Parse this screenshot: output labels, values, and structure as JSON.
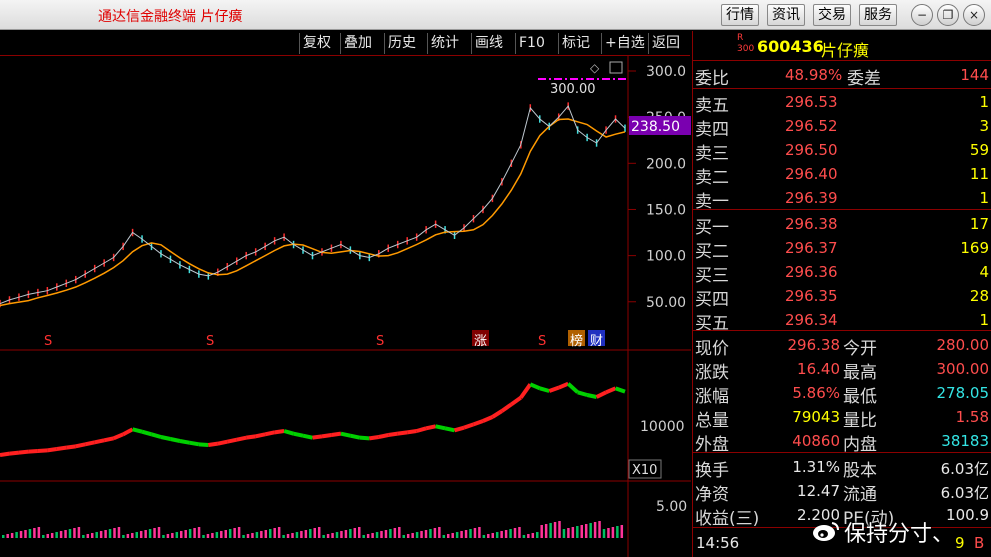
{
  "titlebar": {
    "app_title": "通达信金融终端  片仔癀",
    "buttons": [
      "行情",
      "资讯",
      "交易",
      "服务"
    ],
    "window_controls": [
      "minimize-icon",
      "restore-icon",
      "close-icon"
    ]
  },
  "toolbar": {
    "items": [
      "复权",
      "叠加",
      "历史",
      "统计",
      "画线",
      "F10",
      "标记",
      "+自选",
      "返回"
    ]
  },
  "chart": {
    "price_axis_labels": [
      "300.0",
      "250.0",
      "200.0",
      "150.0",
      "100.0",
      "50.00"
    ],
    "current_price_tag": "238.50",
    "high_marker": "300.00",
    "volume_axis_label": "10000",
    "volume_scale": "X10",
    "indicator_axis_label": "5.00",
    "event_markers": [
      "S",
      "S",
      "S",
      "涨",
      "S",
      "榜",
      "财"
    ],
    "colors": {
      "up": "#ff2020",
      "down": "#00d000",
      "ma": "#ff9a00",
      "tag": "#7a00b0"
    }
  },
  "chart_data": {
    "type": "line",
    "title": "",
    "xlabel": "",
    "ylabel": "",
    "ylim": [
      40,
      300
    ],
    "series": [
      {
        "values": [
          48,
          52,
          55,
          58,
          60,
          62,
          66,
          70,
          74,
          80,
          86,
          92,
          98,
          110,
          125,
          118,
          110,
          102,
          96,
          90,
          85,
          80,
          78,
          82,
          88,
          94,
          100,
          104,
          110,
          116,
          120,
          112,
          106,
          100,
          104,
          108,
          112,
          106,
          100,
          98,
          102,
          108,
          112,
          116,
          120,
          128,
          134,
          128,
          122,
          130,
          140,
          150,
          162,
          180,
          200,
          220,
          260,
          248,
          240,
          250,
          262,
          236,
          228,
          222,
          236,
          248,
          238
        ]
      }
    ],
    "volume": {
      "ylim": [
        0,
        20000
      ]
    },
    "indicator": {
      "ylim": [
        0,
        10
      ]
    }
  },
  "panel": {
    "badge_r": "R",
    "badge_300": "300",
    "code": "600436",
    "name": "片仔癀",
    "weibi": {
      "label": "委比",
      "value": "48.98%",
      "label2": "委差",
      "value2": "144"
    },
    "asks": [
      {
        "label": "卖五",
        "price": "296.53",
        "vol": "1"
      },
      {
        "label": "卖四",
        "price": "296.52",
        "vol": "3"
      },
      {
        "label": "卖三",
        "price": "296.50",
        "vol": "59"
      },
      {
        "label": "卖二",
        "price": "296.40",
        "vol": "11"
      },
      {
        "label": "卖一",
        "price": "296.39",
        "vol": "1"
      }
    ],
    "bids": [
      {
        "label": "买一",
        "price": "296.38",
        "vol": "17"
      },
      {
        "label": "买二",
        "price": "296.37",
        "vol": "169"
      },
      {
        "label": "买三",
        "price": "296.36",
        "vol": "4"
      },
      {
        "label": "买四",
        "price": "296.35",
        "vol": "28"
      },
      {
        "label": "买五",
        "price": "296.34",
        "vol": "1"
      }
    ],
    "stats": [
      {
        "l1": "现价",
        "v1": "296.38",
        "l2": "今开",
        "v2": "280.00"
      },
      {
        "l1": "涨跌",
        "v1": "16.40",
        "l2": "最高",
        "v2": "300.00"
      },
      {
        "l1": "涨幅",
        "v1": "5.86%",
        "l2": "最低",
        "v2": "278.05"
      },
      {
        "l1": "总量",
        "v1": "79043",
        "l2": "量比",
        "v2": "1.58"
      },
      {
        "l1": "外盘",
        "v1": "40860",
        "l2": "内盘",
        "v2": "38183"
      }
    ],
    "stats2": [
      {
        "l1": "换手",
        "v1": "1.31%",
        "l2": "股本",
        "v2": "6.03亿"
      },
      {
        "l1": "净资",
        "v1": "12.47",
        "l2": "流通",
        "v2": "6.03亿"
      },
      {
        "l1": "收益(三)",
        "v1": "2.200",
        "l2": "PE(动)",
        "v2": "100.9"
      }
    ],
    "last_row": {
      "time": "14:56",
      "vol": "9",
      "side": "B"
    }
  },
  "watermark": "保持分寸、"
}
